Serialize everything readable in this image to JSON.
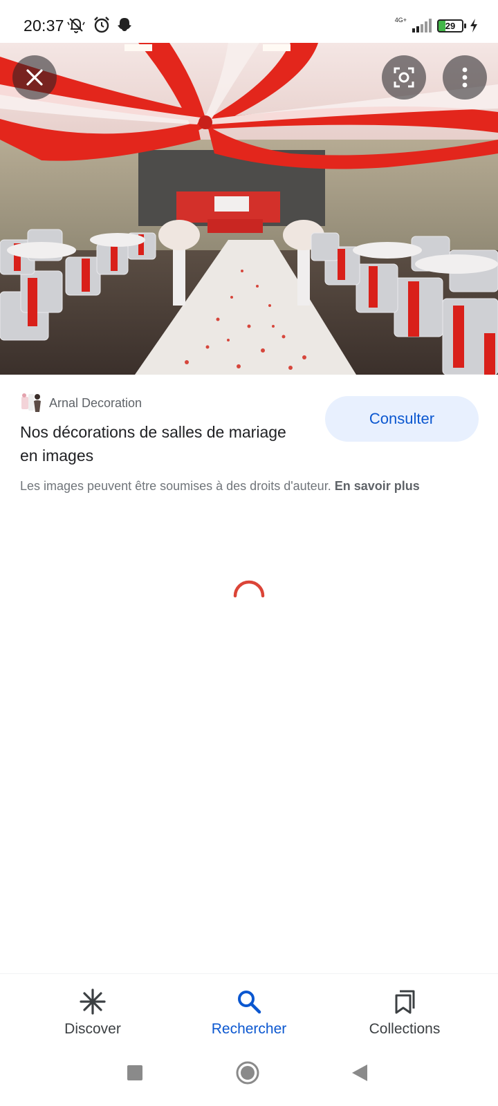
{
  "status_bar": {
    "time": "20:37",
    "network_type": "4G+",
    "battery_level": "29",
    "icons": [
      "mute-icon",
      "alarm-icon",
      "snapchat-icon",
      "signal-icon",
      "battery-icon",
      "charging-icon"
    ]
  },
  "viewer": {
    "close_icon": "close-icon",
    "lens_icon": "lens-icon",
    "more_icon": "more-vert-icon"
  },
  "result": {
    "source_name": "Arnal Decoration",
    "title": "Nos décorations de salles de mariage en images",
    "visit_label": "Consulter",
    "copyright_text": "Les images peuvent être soumises à des droits d'auteur.",
    "learn_more": "En savoir plus"
  },
  "bottom_nav": {
    "items": [
      {
        "label": "Discover",
        "icon": "discover-icon",
        "active": false
      },
      {
        "label": "Rechercher",
        "icon": "search-icon",
        "active": true
      },
      {
        "label": "Collections",
        "icon": "collections-icon",
        "active": false
      }
    ]
  },
  "colors": {
    "accent": "#0b57d0",
    "visit_button_bg": "#e8f0fe",
    "spinner": "#db4437",
    "fabric_red": "#e3261c"
  }
}
